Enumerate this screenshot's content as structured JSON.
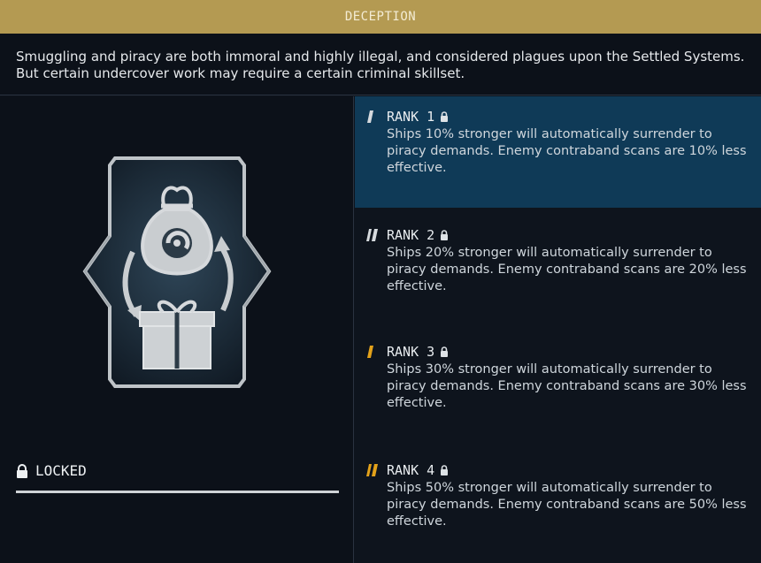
{
  "header": {
    "title": "DECEPTION"
  },
  "description": "Smuggling and piracy are both immoral and highly illegal, and considered plagues upon the Settled Systems. But certain undercover work may require a certain criminal skillset.",
  "status": {
    "label": "LOCKED"
  },
  "ranks": [
    {
      "label": "RANK 1",
      "text": "Ships 10% stronger will automatically surrender to piracy demands. Enemy contraband scans are 10% less effective."
    },
    {
      "label": "RANK 2",
      "text": "Ships 20% stronger will automatically surrender to piracy demands. Enemy contraband scans are 20% less effective."
    },
    {
      "label": "RANK 3",
      "text": "Ships 30% stronger will automatically surrender to piracy demands. Enemy contraband scans are 30% less effective."
    },
    {
      "label": "RANK 4",
      "text": "Ships 50% stronger will automatically surrender to piracy demands. Enemy contraband scans are 50% less effective."
    }
  ],
  "colors": {
    "header": "#b49a52",
    "active_rank": "#0f3a57",
    "tier_accent": "#e3a21a"
  }
}
